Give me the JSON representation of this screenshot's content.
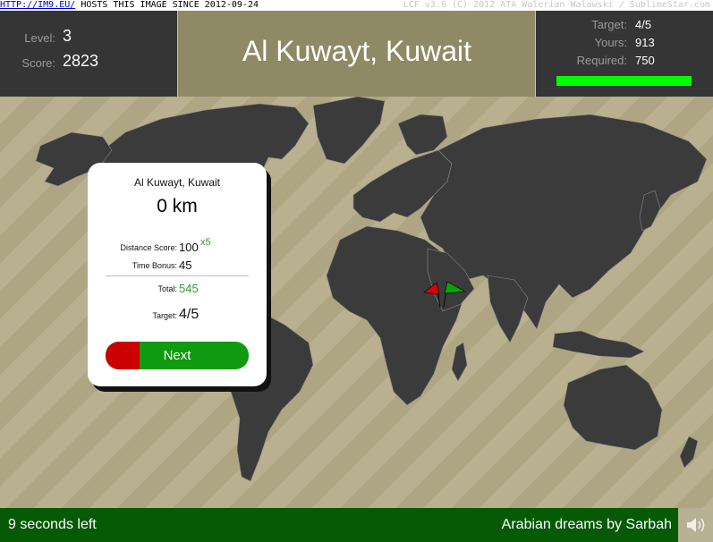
{
  "watermark": {
    "link": "HTTP://IM9.EU/",
    "text": " HOSTS THIS IMAGE SINCE 2012-09-24",
    "right": "LCF v3.6 (C) 2012 ATA Walerian Walawski / SublimeStar.com"
  },
  "stats": {
    "level_label": "Level:",
    "level_value": "3",
    "score_label": "Score:",
    "score_value": "2823"
  },
  "question": {
    "city": "Al Kuwayt, Kuwait"
  },
  "target_panel": {
    "target_label": "Target:",
    "target_value": "4/5",
    "yours_label": "Yours:",
    "yours_value": "913",
    "required_label": "Required:",
    "required_value": "750"
  },
  "result": {
    "city": "Al Kuwayt, Kuwait",
    "distance": "0 km",
    "distance_score_label": "Distance Score:",
    "distance_score_value": "100",
    "multiplier": "x5",
    "time_bonus_label": "Time Bonus:",
    "time_bonus_value": "45",
    "total_label": "Total:",
    "total_value": "545",
    "target_label": "Target:",
    "target_value": "4/5",
    "next_label": "Next"
  },
  "footer": {
    "timer": "9 seconds left",
    "song": "Arabian dreams by Sarbah"
  },
  "colors": {
    "panel_dark": "#353535",
    "title_bg": "#8f8a65",
    "progress": "#00ff00",
    "footer_bg": "#065a06",
    "flag_guess": "#dd0000",
    "flag_answer": "#00aa00"
  },
  "icons": {
    "guess_flag": "red-flag-icon",
    "answer_flag": "green-flag-icon",
    "sound": "speaker-icon"
  }
}
